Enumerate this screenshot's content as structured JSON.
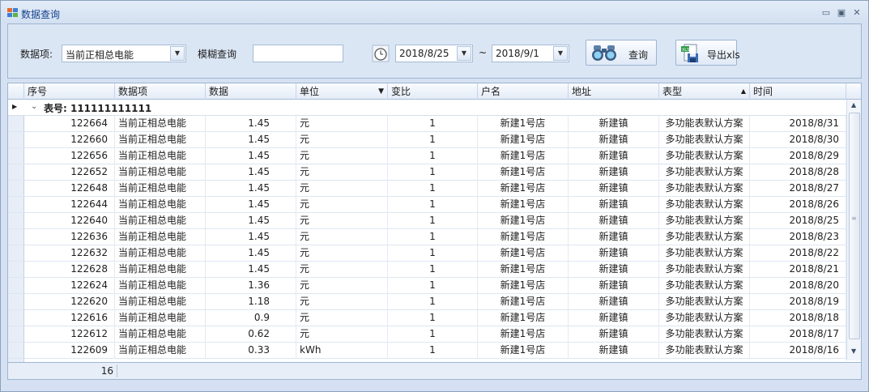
{
  "window": {
    "title": "数据查询",
    "minimize_glyph": "▭",
    "maximize_glyph": "▣",
    "close_glyph": "✕"
  },
  "toolbar": {
    "data_item_label": "数据项:",
    "data_item_value": "当前正相总电能",
    "fuzzy_label": "模糊查询",
    "fuzzy_value": "",
    "date_from": "2018/8/25",
    "tilde": "~",
    "date_to": "2018/9/1",
    "query_label": "查询",
    "export_label": "导出xls"
  },
  "grid": {
    "columns": [
      "序号",
      "数据项",
      "数据",
      "单位",
      "变比",
      "户名",
      "地址",
      "表型",
      "时间"
    ],
    "group_label": "表号: 111111111111",
    "rows": [
      [
        "122664",
        "当前正相总电能",
        "1.45",
        "元",
        "1",
        "新建1号店",
        "新建镇",
        "多功能表默认方案",
        "2018/8/31"
      ],
      [
        "122660",
        "当前正相总电能",
        "1.45",
        "元",
        "1",
        "新建1号店",
        "新建镇",
        "多功能表默认方案",
        "2018/8/30"
      ],
      [
        "122656",
        "当前正相总电能",
        "1.45",
        "元",
        "1",
        "新建1号店",
        "新建镇",
        "多功能表默认方案",
        "2018/8/29"
      ],
      [
        "122652",
        "当前正相总电能",
        "1.45",
        "元",
        "1",
        "新建1号店",
        "新建镇",
        "多功能表默认方案",
        "2018/8/28"
      ],
      [
        "122648",
        "当前正相总电能",
        "1.45",
        "元",
        "1",
        "新建1号店",
        "新建镇",
        "多功能表默认方案",
        "2018/8/27"
      ],
      [
        "122644",
        "当前正相总电能",
        "1.45",
        "元",
        "1",
        "新建1号店",
        "新建镇",
        "多功能表默认方案",
        "2018/8/26"
      ],
      [
        "122640",
        "当前正相总电能",
        "1.45",
        "元",
        "1",
        "新建1号店",
        "新建镇",
        "多功能表默认方案",
        "2018/8/25"
      ],
      [
        "122636",
        "当前正相总电能",
        "1.45",
        "元",
        "1",
        "新建1号店",
        "新建镇",
        "多功能表默认方案",
        "2018/8/23"
      ],
      [
        "122632",
        "当前正相总电能",
        "1.45",
        "元",
        "1",
        "新建1号店",
        "新建镇",
        "多功能表默认方案",
        "2018/8/22"
      ],
      [
        "122628",
        "当前正相总电能",
        "1.45",
        "元",
        "1",
        "新建1号店",
        "新建镇",
        "多功能表默认方案",
        "2018/8/21"
      ],
      [
        "122624",
        "当前正相总电能",
        "1.36",
        "元",
        "1",
        "新建1号店",
        "新建镇",
        "多功能表默认方案",
        "2018/8/20"
      ],
      [
        "122620",
        "当前正相总电能",
        "1.18",
        "元",
        "1",
        "新建1号店",
        "新建镇",
        "多功能表默认方案",
        "2018/8/19"
      ],
      [
        "122616",
        "当前正相总电能",
        "0.9",
        "元",
        "1",
        "新建1号店",
        "新建镇",
        "多功能表默认方案",
        "2018/8/18"
      ],
      [
        "122612",
        "当前正相总电能",
        "0.62",
        "元",
        "1",
        "新建1号店",
        "新建镇",
        "多功能表默认方案",
        "2018/8/17"
      ],
      [
        "122609",
        "当前正相总电能",
        "0.33",
        "kWh",
        "1",
        "新建1号店",
        "新建镇",
        "多功能表默认方案",
        "2018/8/16"
      ]
    ],
    "footer_count": "16"
  },
  "colors": {
    "accent": "#15428b",
    "header_bg": "#e4ecf7",
    "frame_bg": "#d5e1f2"
  }
}
